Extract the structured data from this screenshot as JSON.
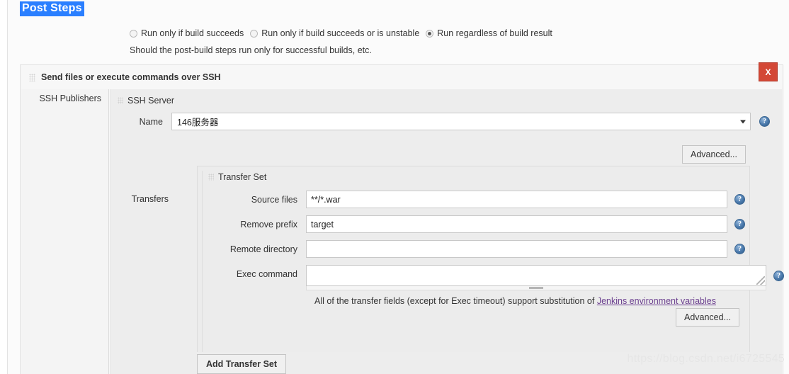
{
  "page": {
    "section_title": "Post Steps",
    "watermark": "https://blog.csdn.net/i6725545"
  },
  "post_steps": {
    "radios": [
      {
        "label": "Run only if build succeeds",
        "selected": false
      },
      {
        "label": "Run only if build succeeds or is unstable",
        "selected": false
      },
      {
        "label": "Run regardless of build result",
        "selected": true
      }
    ],
    "hint": "Should the post-build steps run only for successful builds, etc."
  },
  "publisher": {
    "title": "Send files or execute commands over SSH",
    "close_label": "X",
    "left_column_label": "SSH Publishers",
    "grip_icon": "drag-handle-icon",
    "help_icon": "help-question-icon"
  },
  "ssh_server": {
    "title": "SSH Server",
    "name_label": "Name",
    "name_value": "146服务器",
    "caret_icon": "chevron-down-icon",
    "advanced_label": "Advanced..."
  },
  "transfers": {
    "label": "Transfers",
    "set_title": "Transfer Set",
    "fields": [
      {
        "label": "Source files",
        "value": "**/*.war"
      },
      {
        "label": "Remove prefix",
        "value": "target"
      },
      {
        "label": "Remote directory",
        "value": ""
      }
    ],
    "exec_label": "Exec command",
    "exec_value": "",
    "note_prefix": "All of the transfer fields (except for Exec timeout) support substitution of ",
    "note_link": "Jenkins environment variables",
    "advanced_label": "Advanced...",
    "add_button_label": "Add Transfer Set"
  }
}
